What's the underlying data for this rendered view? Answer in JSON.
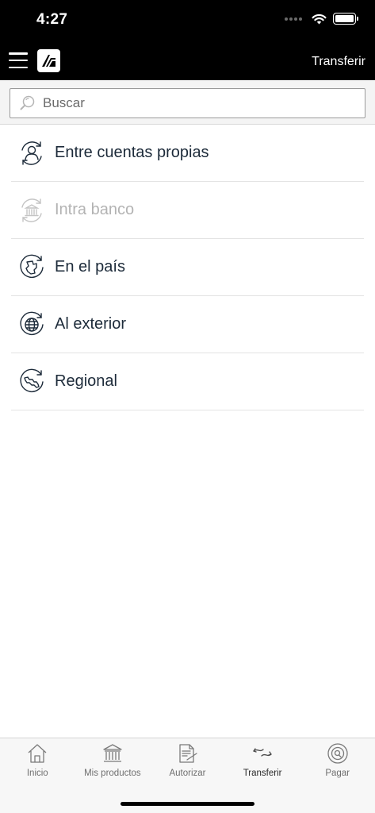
{
  "status_bar": {
    "time": "4:27"
  },
  "nav": {
    "title": "Transferir"
  },
  "search": {
    "placeholder": "Buscar"
  },
  "items": [
    {
      "label": "Entre cuentas propias",
      "icon": "user-transfer-icon",
      "enabled": true
    },
    {
      "label": "Intra banco",
      "icon": "bank-transfer-icon",
      "enabled": false
    },
    {
      "label": "En el país",
      "icon": "country-map-icon",
      "enabled": true
    },
    {
      "label": "Al exterior",
      "icon": "globe-icon",
      "enabled": true
    },
    {
      "label": "Regional",
      "icon": "region-map-icon",
      "enabled": true
    }
  ],
  "tabs": [
    {
      "label": "Inicio",
      "icon": "home-icon",
      "active": false
    },
    {
      "label": "Mis productos",
      "icon": "bank-icon",
      "active": false
    },
    {
      "label": "Autorizar",
      "icon": "document-sign-icon",
      "active": false
    },
    {
      "label": "Transferir",
      "icon": "transfer-arrows-icon",
      "active": true
    },
    {
      "label": "Pagar",
      "icon": "pay-coin-icon",
      "active": false
    }
  ],
  "colors": {
    "topbar": "#000000",
    "text": "#1d2b3a",
    "disabled_text": "#b3b3b3"
  }
}
